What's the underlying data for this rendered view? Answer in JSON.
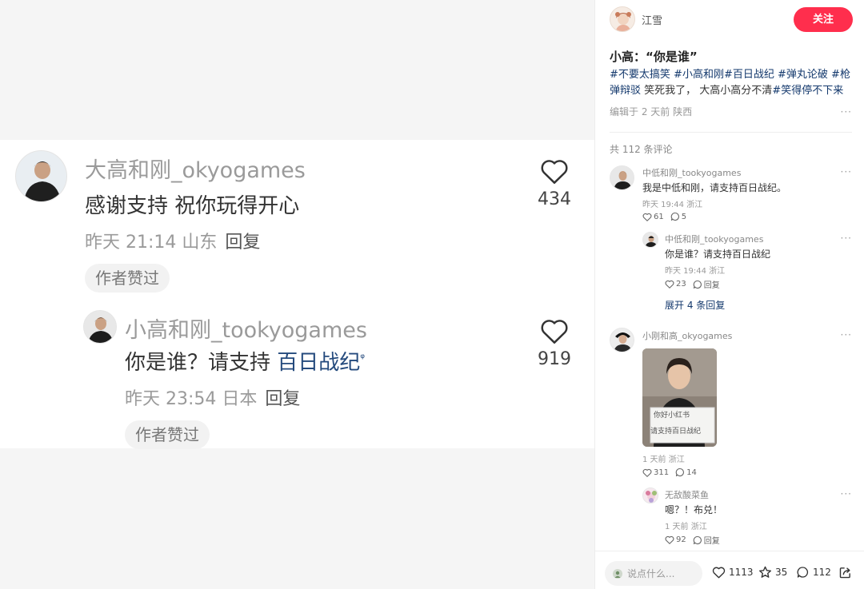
{
  "screenshot": {
    "comment1": {
      "user": "大高和刚_okyogames",
      "text": "感谢支持 祝你玩得开心",
      "meta": "昨天 21:14 山东",
      "reply": "回复",
      "badge": "作者赞过",
      "likes": "434"
    },
    "comment2": {
      "user": "小高和刚_tookyogames",
      "text_prefix": "你是谁？请支持 ",
      "text_link": "百日战纪",
      "text_link_mark": "ᵠ",
      "meta": "昨天 23:54 日本",
      "reply": "回复",
      "badge": "作者赞过",
      "likes": "919"
    }
  },
  "author": {
    "name": "江雪",
    "follow_label": "关注"
  },
  "note": {
    "title": "小高：“你是谁”",
    "tags": [
      "#不要太搞笑",
      "#小高和刚",
      "#百日战纪",
      "#弹丸论破",
      "#枪弹辩驳"
    ],
    "desc_text": "笑死我了， 大高小高分不清",
    "desc_tag": "#笑得停不下来",
    "meta": "编辑于 2 天前 陕西"
  },
  "comments_header": "共 112 条评论",
  "comments": [
    {
      "user": "中低和刚_tookyogames",
      "text": "我是中低和刚，请支持百日战纪。",
      "meta": "昨天 19:44 浙江",
      "likes": "61",
      "replies": "5",
      "sub": {
        "user": "中低和刚_tookyogames",
        "text": "你是谁？请支持百日战纪",
        "meta": "昨天 19:44 浙江",
        "likes": "23",
        "reply_label": "回复"
      },
      "expand_label": "展开 4 条回复"
    },
    {
      "user": "小刚和高_okyogames",
      "image_text_line1": "你好小红书",
      "image_text_line2": "请支持百日战纪",
      "meta": "1 天前 浙江",
      "likes": "311",
      "replies": "14",
      "sub": {
        "user": "无敌酸菜鱼",
        "text": "嗯？！布兑！",
        "meta": "1 天前 浙江",
        "likes": "92",
        "reply_label": "回复"
      }
    }
  ],
  "bottom_bar": {
    "placeholder": "说点什么...",
    "likes": "1113",
    "stars": "35",
    "comments": "112"
  },
  "colors": {
    "accent": "#ff2e4d",
    "link": "#13386c",
    "muted": "#999999"
  }
}
